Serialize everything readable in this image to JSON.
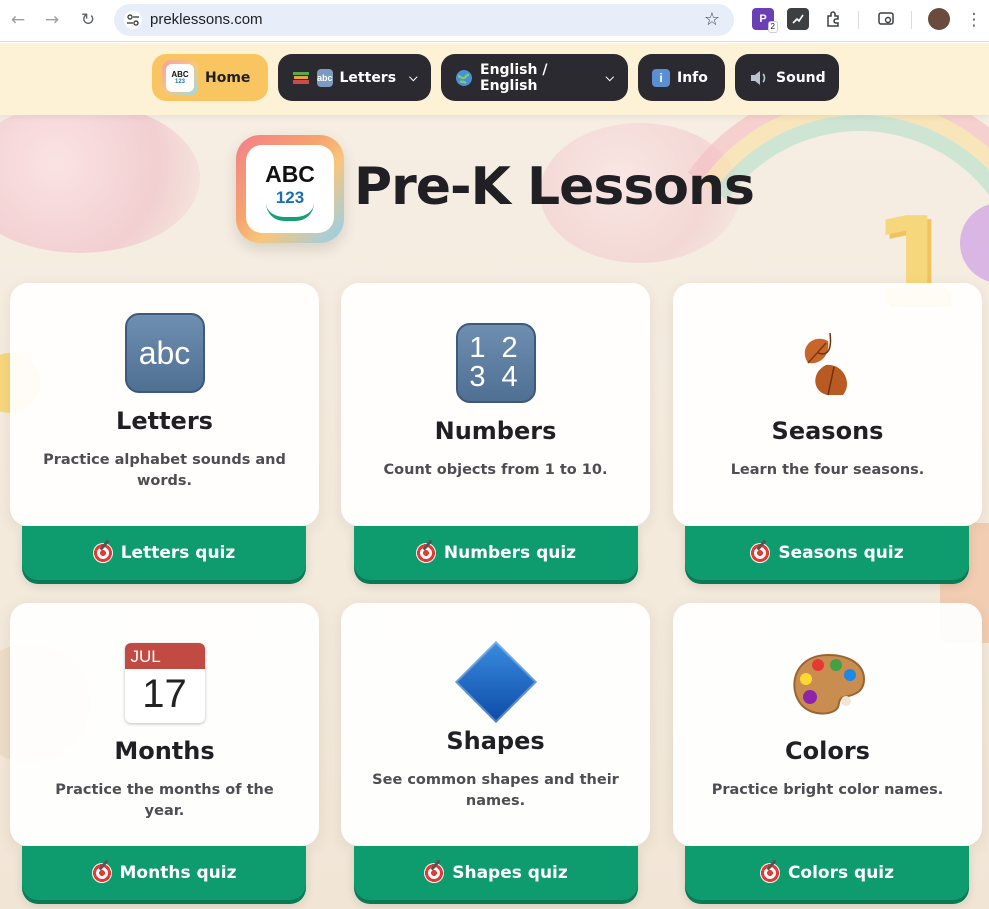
{
  "browser": {
    "url": "preklessons.com",
    "extension_badge": "2"
  },
  "nav": {
    "home_label": "Home",
    "home_icon_abc": "ABC",
    "home_icon_123": "123",
    "letters_label": "Letters",
    "letters_icon_text": "abc",
    "language_label": "English / English",
    "info_label": "Info",
    "info_icon_text": "i",
    "sound_label": "Sound"
  },
  "hero": {
    "icon_abc": "ABC",
    "icon_123": "123",
    "title": "Pre-K Lessons"
  },
  "cards": [
    {
      "title": "Letters",
      "description": "Practice alphabet sounds and words.",
      "quiz_label": "Letters quiz",
      "icon": "abc-tile-icon",
      "icon_text": "abc"
    },
    {
      "title": "Numbers",
      "description": "Count objects from 1 to 10.",
      "quiz_label": "Numbers quiz",
      "icon": "numbers-tile-icon",
      "icon_text_1": "1 2",
      "icon_text_2": "3 4"
    },
    {
      "title": "Seasons",
      "description": "Learn the four seasons.",
      "quiz_label": "Seasons quiz",
      "icon": "fallen-leaves-icon"
    },
    {
      "title": "Months",
      "description": "Practice the months of the year.",
      "quiz_label": "Months quiz",
      "icon": "calendar-icon",
      "icon_month": "JUL",
      "icon_day": "17"
    },
    {
      "title": "Shapes",
      "description": "See common shapes and their names.",
      "quiz_label": "Shapes quiz",
      "icon": "blue-diamond-icon"
    },
    {
      "title": "Colors",
      "description": "Practice bright color names.",
      "quiz_label": "Colors quiz",
      "icon": "artist-palette-icon"
    }
  ],
  "colors": {
    "quiz_green": "#0e9b6e",
    "home_yellow": "#f8c561",
    "nav_dark": "#2a2a30"
  }
}
